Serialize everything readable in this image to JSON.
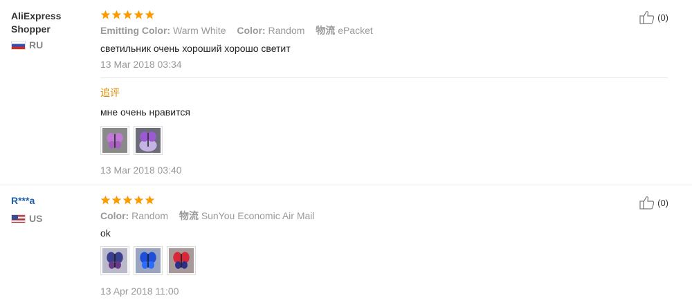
{
  "reviews": [
    {
      "user": "AliExpress Shopper",
      "country": "RU",
      "rating": 5,
      "meta": [
        {
          "key": "Emitting Color:",
          "value": "Warm White"
        },
        {
          "key": "Color:",
          "value": "Random"
        },
        {
          "key": "物流",
          "value": "ePacket"
        }
      ],
      "text": "светильник очень хороший хорошо светит",
      "date": "13 Mar 2018 03:34",
      "additional": {
        "title": "追评",
        "text": "мне очень нравится",
        "date": "13 Mar 2018 03:40"
      },
      "likes": "(0)"
    },
    {
      "user": "R***a",
      "country": "US",
      "rating": 5,
      "meta": [
        {
          "key": "Color:",
          "value": "Random"
        },
        {
          "key": "物流",
          "value": "SunYou Economic Air Mail"
        }
      ],
      "text": "ok",
      "date": "13 Apr 2018 11:00",
      "likes": "(0)"
    }
  ],
  "colors": {
    "star": "#ff9a00",
    "link": "#1a5fa8",
    "followup": "#e08a00"
  }
}
